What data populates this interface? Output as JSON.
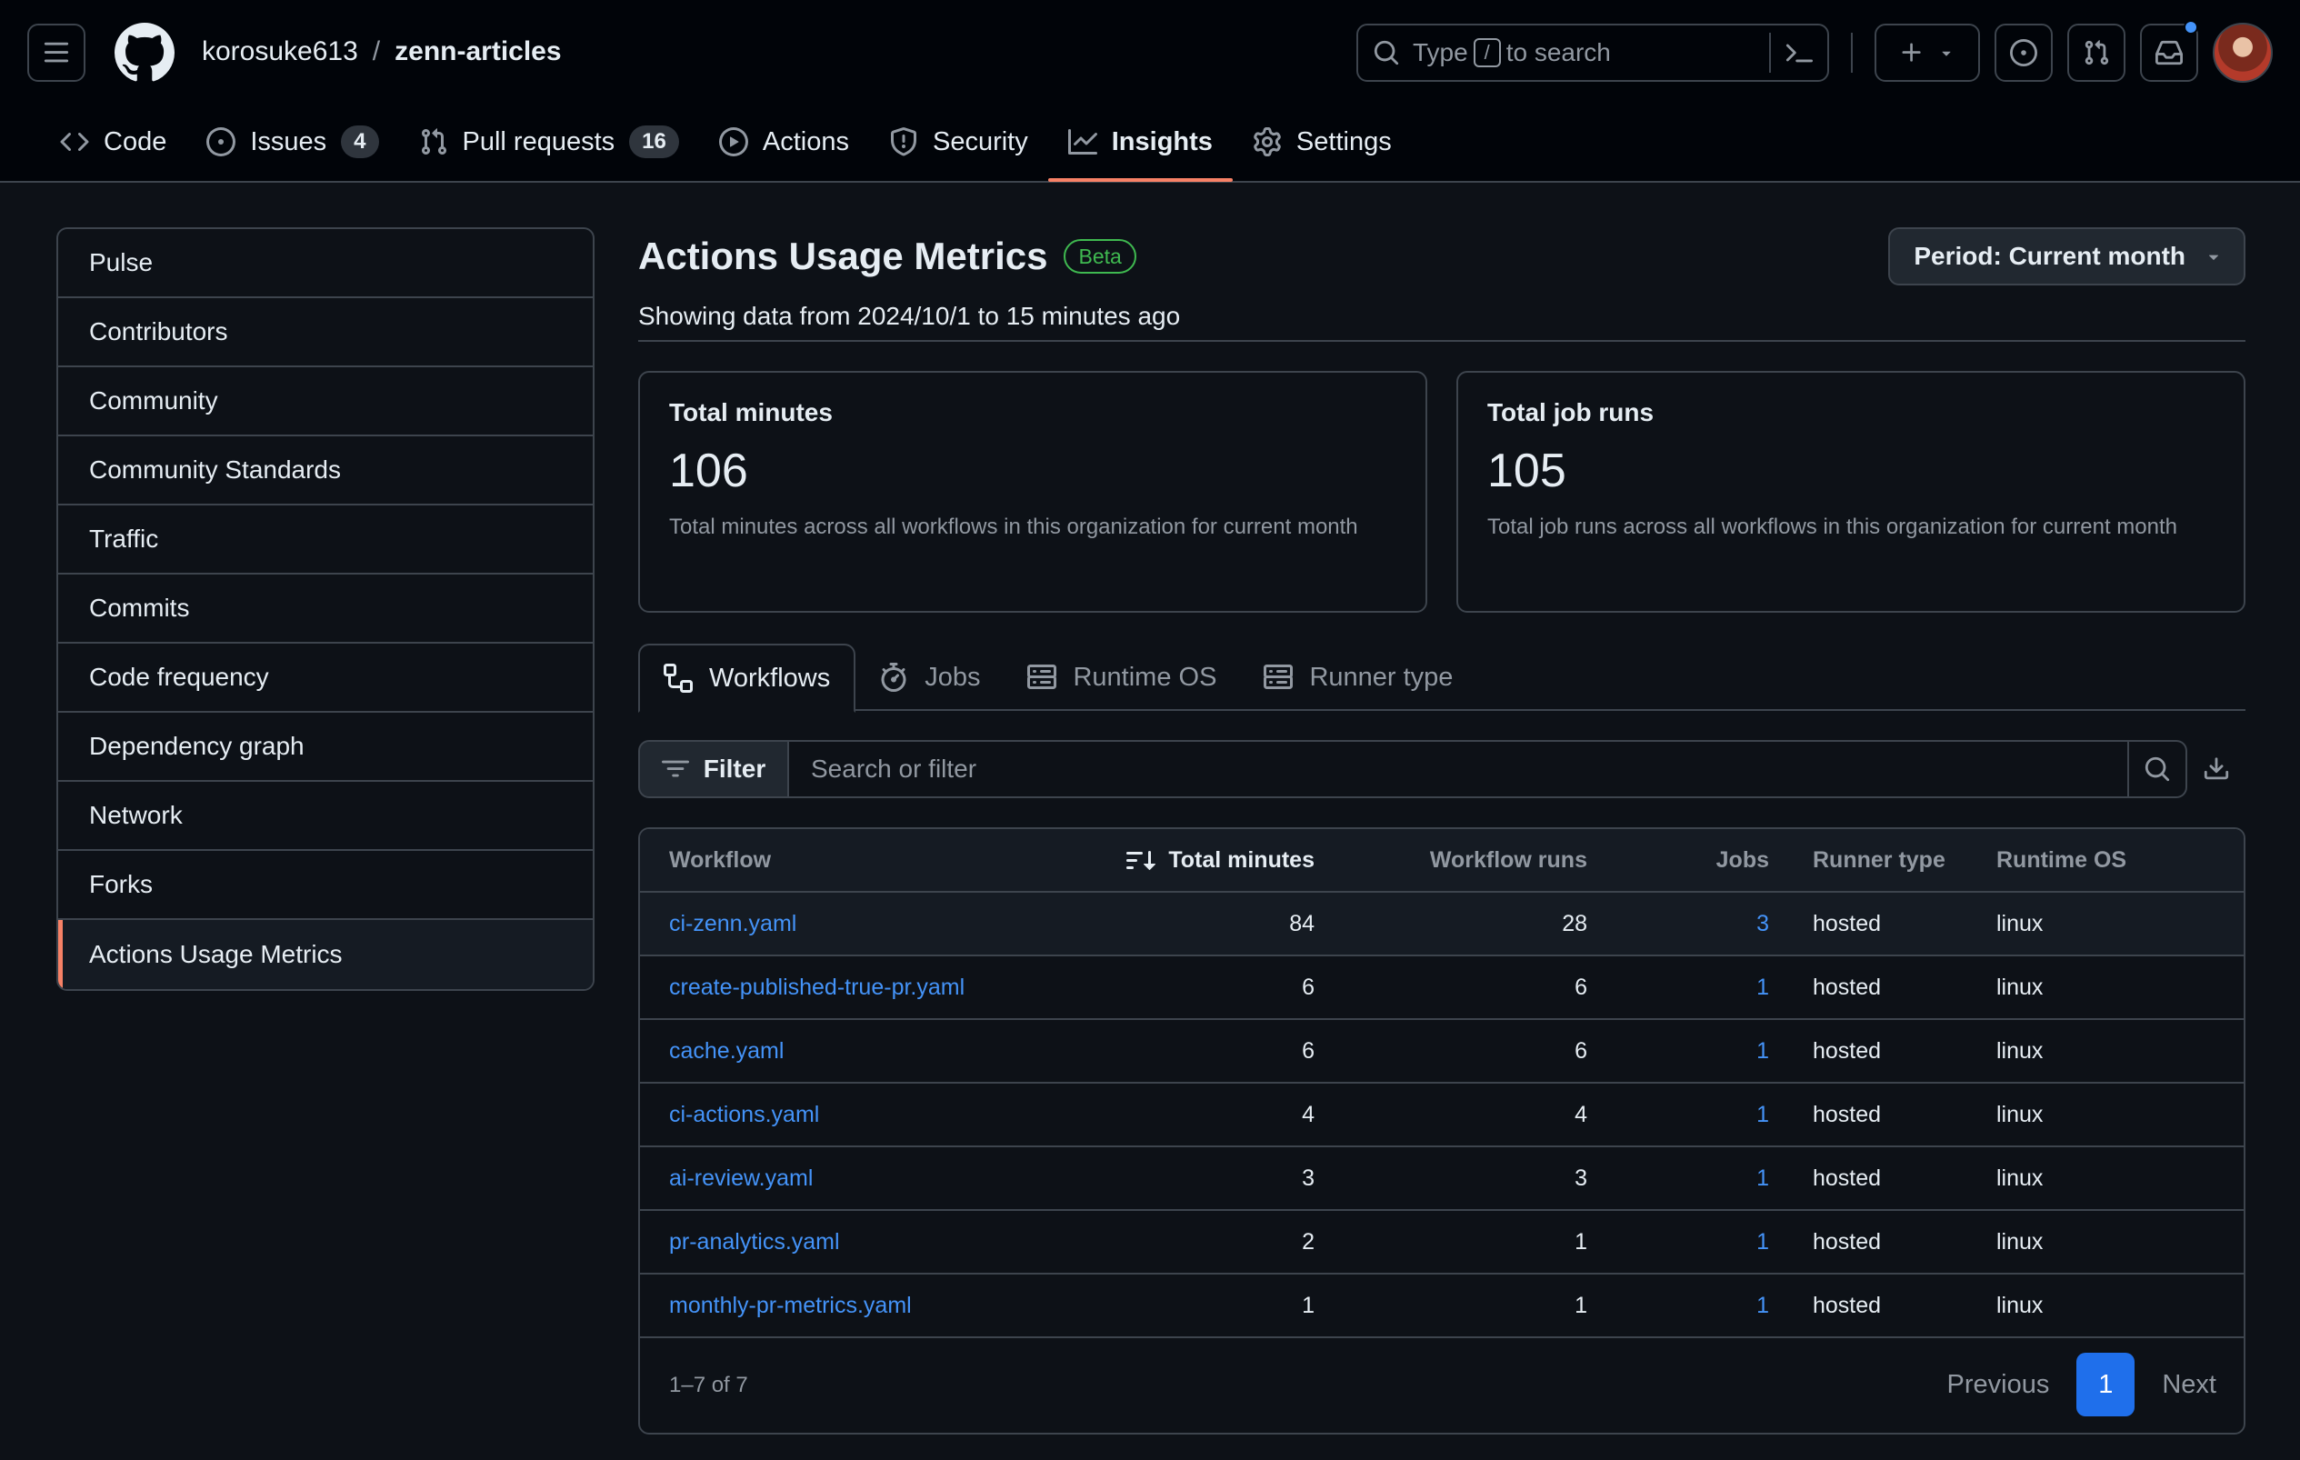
{
  "repo": {
    "owner": "korosuke613",
    "separator": "/",
    "name": "zenn-articles"
  },
  "search": {
    "prefix": "Type",
    "key": "/",
    "suffix": "to search"
  },
  "nav": [
    {
      "label": "Code",
      "icon": "code-icon"
    },
    {
      "label": "Issues",
      "icon": "issue-icon",
      "count": "4"
    },
    {
      "label": "Pull requests",
      "icon": "pull-request-icon",
      "count": "16"
    },
    {
      "label": "Actions",
      "icon": "play-icon"
    },
    {
      "label": "Security",
      "icon": "shield-icon"
    },
    {
      "label": "Insights",
      "icon": "graph-icon",
      "active": true
    },
    {
      "label": "Settings",
      "icon": "gear-icon"
    }
  ],
  "sidebar": {
    "items": [
      {
        "label": "Pulse"
      },
      {
        "label": "Contributors"
      },
      {
        "label": "Community"
      },
      {
        "label": "Community Standards"
      },
      {
        "label": "Traffic"
      },
      {
        "label": "Commits"
      },
      {
        "label": "Code frequency"
      },
      {
        "label": "Dependency graph"
      },
      {
        "label": "Network"
      },
      {
        "label": "Forks"
      },
      {
        "label": "Actions Usage Metrics",
        "active": true
      }
    ]
  },
  "main": {
    "title": "Actions Usage Metrics",
    "badge": "Beta",
    "period_label": "Period: Current month",
    "showing": "Showing data from 2024/10/1 to 15 minutes ago",
    "cards": [
      {
        "title": "Total minutes",
        "value": "106",
        "desc": "Total minutes across all workflows in this organization for current month"
      },
      {
        "title": "Total job runs",
        "value": "105",
        "desc": "Total job runs across all workflows in this organization for current month"
      }
    ],
    "tabs": [
      {
        "label": "Workflows",
        "icon": "workflow-icon",
        "active": true
      },
      {
        "label": "Jobs",
        "icon": "stopwatch-icon"
      },
      {
        "label": "Runtime OS",
        "icon": "server-icon"
      },
      {
        "label": "Runner type",
        "icon": "server-icon"
      }
    ],
    "filter": {
      "button": "Filter",
      "placeholder": "Search or filter"
    },
    "table": {
      "headers": {
        "workflow": "Workflow",
        "minutes": "Total minutes",
        "runs": "Workflow runs",
        "jobs": "Jobs",
        "runner": "Runner type",
        "os": "Runtime OS"
      },
      "rows": [
        {
          "workflow": "ci-zenn.yaml",
          "minutes": "84",
          "runs": "28",
          "jobs": "3",
          "runner": "hosted",
          "os": "linux"
        },
        {
          "workflow": "create-published-true-pr.yaml",
          "minutes": "6",
          "runs": "6",
          "jobs": "1",
          "runner": "hosted",
          "os": "linux"
        },
        {
          "workflow": "cache.yaml",
          "minutes": "6",
          "runs": "6",
          "jobs": "1",
          "runner": "hosted",
          "os": "linux"
        },
        {
          "workflow": "ci-actions.yaml",
          "minutes": "4",
          "runs": "4",
          "jobs": "1",
          "runner": "hosted",
          "os": "linux"
        },
        {
          "workflow": "ai-review.yaml",
          "minutes": "3",
          "runs": "3",
          "jobs": "1",
          "runner": "hosted",
          "os": "linux"
        },
        {
          "workflow": "pr-analytics.yaml",
          "minutes": "2",
          "runs": "1",
          "jobs": "1",
          "runner": "hosted",
          "os": "linux"
        },
        {
          "workflow": "monthly-pr-metrics.yaml",
          "minutes": "1",
          "runs": "1",
          "jobs": "1",
          "runner": "hosted",
          "os": "linux"
        }
      ],
      "range": "1–7 of 7",
      "pager": {
        "previous": "Previous",
        "current": "1",
        "next": "Next"
      }
    }
  },
  "colors": {
    "accent": "#f78166",
    "link": "#4493f8",
    "beta": "#3fb950",
    "page_current": "#1f6feb",
    "notif_dot": "#4493f8"
  }
}
